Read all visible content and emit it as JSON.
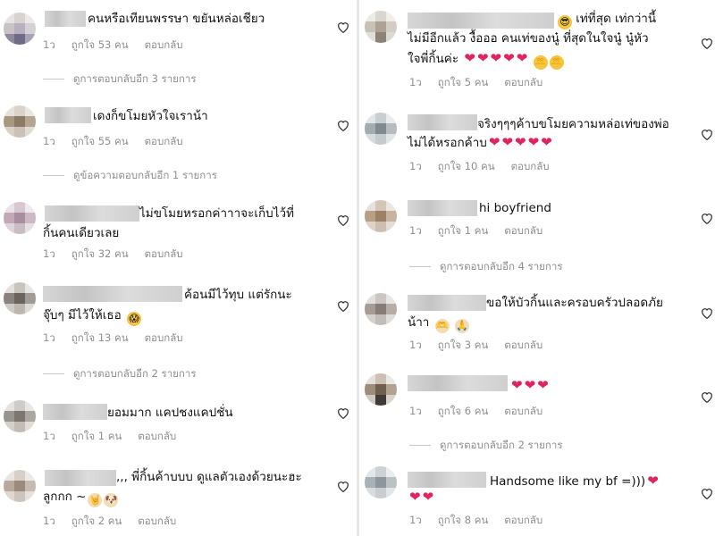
{
  "left": [
    {
      "text": [
        "คนหรือเทียนพรรษา ขยันหล่อเชียว"
      ],
      "meta": [
        "1ว",
        "ถูกใจ 53 คน",
        "ตอบกลับ"
      ],
      "replies": "ดูการตอบกลับอีก 3 รายการ"
    },
    {
      "text": [
        "เดงก็ขโมยหัวใจเราน้า"
      ],
      "meta": [
        "1ว",
        "ถูกใจ 55 คน",
        "ตอบกลับ"
      ],
      "replies": "ดูข้อความตอบกลับอีก 1 รายการ"
    },
    {
      "text": [
        "ไม่ขโมยหรอกค่าาาจะเก็บไว้ที่",
        "กิ้นคนเดียวเลย"
      ],
      "meta": [
        "1ว",
        "ถูกใจ 32 คน",
        "ตอบกลับ"
      ]
    },
    {
      "text": [
        "ค้อนมีไว้ทุบ แต่รักนะ",
        "จุ๊บๆ มีไว้ให้เธอ"
      ],
      "meta": [
        "1ว",
        "ถูกใจ 13 คน",
        "ตอบกลับ"
      ],
      "replies": "ดูการตอบกลับอีก 2 รายการ"
    },
    {
      "text": [
        "ยอมมาก แคปชงแคปชั่น"
      ],
      "meta": [
        "1ว",
        "ถูกใจ 1 คน",
        "ตอบกลับ"
      ]
    },
    {
      "text": [
        ",,, พี่กิ้นค้าบบบ ดูแลตัวเองด้วยนะฮะ",
        "ลูกกก  ~"
      ],
      "meta": [
        "1ว",
        "ถูกใจ 2 คน",
        "ตอบกลับ"
      ]
    }
  ],
  "right": [
    {
      "text": [
        " เท่ที่สุด เท่กว่านี้",
        "ไม่มีอีกแล้ว งื้อออ  คนเท่ของนู๋ ที่สุดในใจนู๋ นู๋หัว",
        "ใจพี่กิ้นค่ะ"
      ],
      "meta": [
        "1ว",
        "ถูกใจ 5 คน",
        "ตอบกลับ"
      ]
    },
    {
      "text": [
        "จริงๆๆๆค้าบขโมยความหล่อเท่ของพ่อ",
        "ไม่ได้หรอกค้าบ"
      ],
      "meta": [
        "1ว",
        "ถูกใจ 10 คน",
        "ตอบกลับ"
      ]
    },
    {
      "text": [
        "hi boyfriend"
      ],
      "meta": [
        "1ว",
        "ถูกใจ 1 คน",
        "ตอบกลับ"
      ],
      "replies": "ดูการตอบกลับอีก 4 รายการ"
    },
    {
      "text": [
        "ขอให้บัวกิ้นและครอบครัวปลอดภัย",
        "น้าา "
      ],
      "meta": [
        "1ว",
        "ถูกใจ 3 คน",
        "ตอบกลับ"
      ]
    },
    {
      "text": [
        ""
      ],
      "meta": [
        "1ว",
        "ถูกใจ 6 คน",
        "ตอบกลับ"
      ],
      "replies": "ดูการตอบกลับอีก 2 รายการ"
    },
    {
      "text": [
        "Handsome like my bf =)))",
        ""
      ],
      "meta": [
        "1ว",
        "ถูกใจ 8 คน",
        "ตอบกลับ"
      ]
    }
  ],
  "emoji": {
    "sunglasses": "😎",
    "heart": "❤",
    "hands_heart": "🫶",
    "scream": "😱",
    "rock": "🤘",
    "dog": "🐶",
    "pray": "🙏"
  },
  "colors": {
    "text": "#262626",
    "meta": "#8e8e8e",
    "heart_red": "#e0245e",
    "blur": "#cfcfcf"
  }
}
